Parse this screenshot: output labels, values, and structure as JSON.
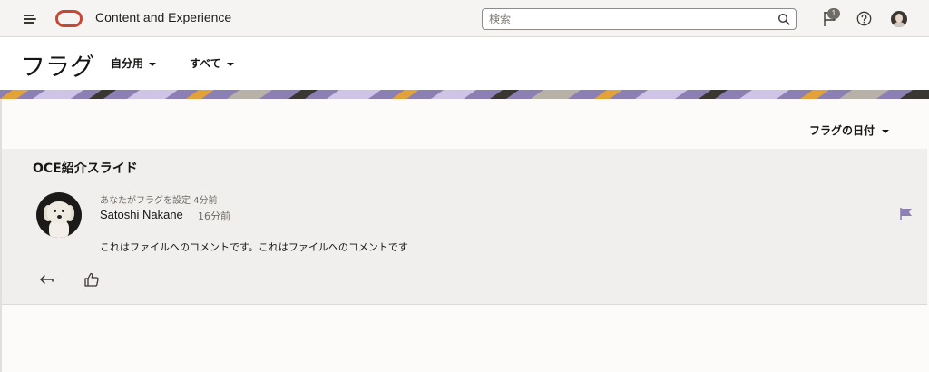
{
  "header": {
    "app_title": "Content and Experience",
    "search_placeholder": "検索",
    "notification_count": "1",
    "icons": [
      "menu-icon",
      "oracle-logo",
      "search-icon",
      "flag-icon",
      "help-icon",
      "user-avatar"
    ]
  },
  "page": {
    "title": "フラグ",
    "filter_owner": "自分用",
    "filter_scope": "すべて",
    "sort_label": "フラグの日付"
  },
  "card": {
    "document_title": "OCE紹介スライド",
    "activity": "あなたがフラグを設定 4分前",
    "author": "Satoshi Nakane",
    "author_time": "16分前",
    "comment": "これはファイルへのコメントです。これはファイルへのコメントです",
    "icons": [
      "reply-icon",
      "like-icon",
      "flag-icon"
    ]
  },
  "colors": {
    "brand": "#c74634",
    "flag": "#8c7fb3",
    "banner_purple": "#8c7fb3",
    "banner_orange": "#e3a13a",
    "banner_lavender": "#cfc3e6"
  }
}
